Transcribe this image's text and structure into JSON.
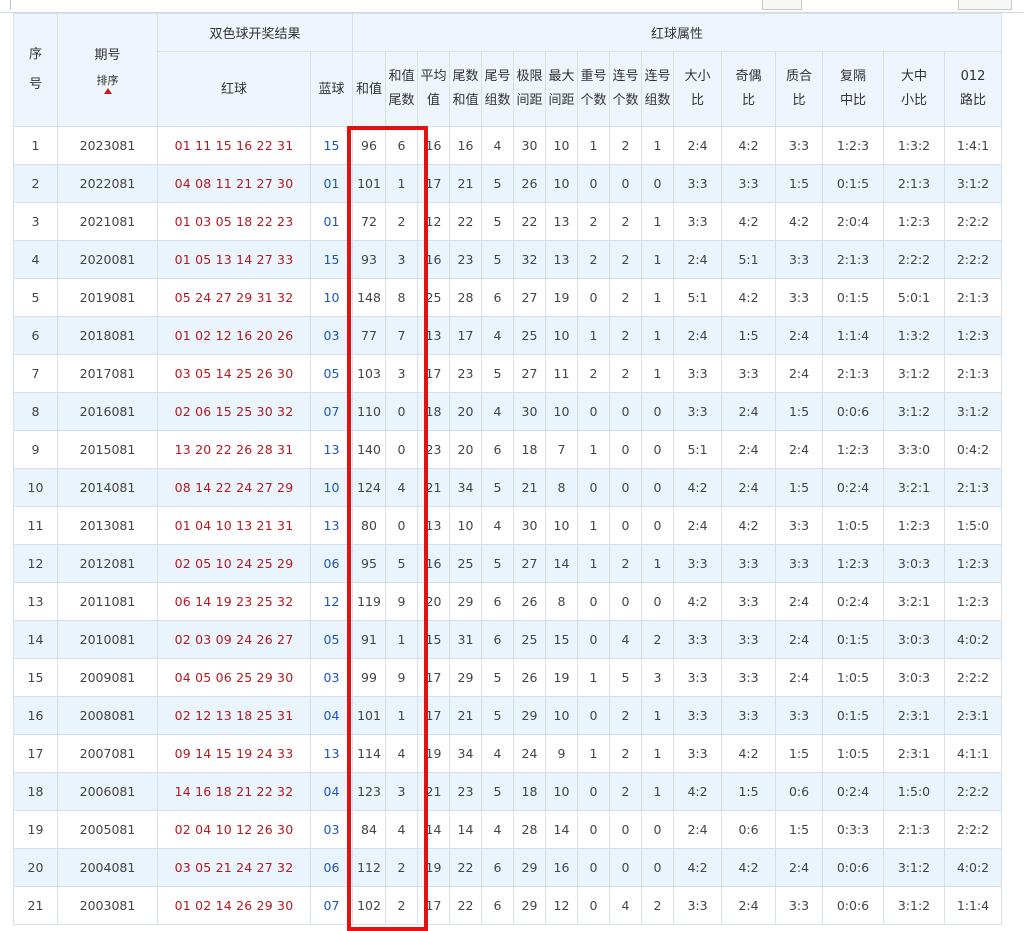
{
  "header": {
    "seq_a": "序",
    "seq_b": "号",
    "period": "期号",
    "sort_label": "排序",
    "result_group": "双色球开奖结果",
    "red_ball": "红球",
    "blue_ball": "蓝球",
    "red_attr_group": "红球属性",
    "cols": {
      "sum": "和值",
      "sum_tail_a": "和值",
      "sum_tail_b": "尾数",
      "avg_a": "平均",
      "avg_b": "值",
      "tail_sum_a": "尾数",
      "tail_sum_b": "和值",
      "tail_groups_a": "尾号",
      "tail_groups_b": "组数",
      "range_a": "极限",
      "range_b": "间距",
      "max_gap_a": "最大",
      "max_gap_b": "间距",
      "repeat_a": "重号",
      "repeat_b": "个数",
      "consec_a": "连号",
      "consec_b": "个数",
      "consec_groups_a": "连号",
      "consec_groups_b": "组数",
      "size_a": "大小",
      "size_b": "比",
      "odd_a": "奇偶",
      "odd_b": "比",
      "prime_a": "质合",
      "prime_b": "比",
      "repeat_ratio_a": "复隔",
      "repeat_ratio_b": "中比",
      "zone_a": "大中",
      "zone_b": "小比",
      "mod_a": "012",
      "mod_b": "路比"
    }
  },
  "rows": [
    [
      "1",
      "2023081",
      "01 11 15 16 22 31",
      "15",
      "96",
      "6",
      "16",
      "16",
      "4",
      "30",
      "10",
      "1",
      "2",
      "1",
      "2:4",
      "4:2",
      "3:3",
      "1:2:3",
      "1:3:2",
      "1:4:1"
    ],
    [
      "2",
      "2022081",
      "04 08 11 21 27 30",
      "01",
      "101",
      "1",
      "17",
      "21",
      "5",
      "26",
      "10",
      "0",
      "0",
      "0",
      "3:3",
      "3:3",
      "1:5",
      "0:1:5",
      "2:1:3",
      "3:1:2"
    ],
    [
      "3",
      "2021081",
      "01 03 05 18 22 23",
      "01",
      "72",
      "2",
      "12",
      "22",
      "5",
      "22",
      "13",
      "2",
      "2",
      "1",
      "3:3",
      "4:2",
      "4:2",
      "2:0:4",
      "1:2:3",
      "2:2:2"
    ],
    [
      "4",
      "2020081",
      "01 05 13 14 27 33",
      "15",
      "93",
      "3",
      "16",
      "23",
      "5",
      "32",
      "13",
      "2",
      "2",
      "1",
      "2:4",
      "5:1",
      "3:3",
      "2:1:3",
      "2:2:2",
      "2:2:2"
    ],
    [
      "5",
      "2019081",
      "05 24 27 29 31 32",
      "10",
      "148",
      "8",
      "25",
      "28",
      "6",
      "27",
      "19",
      "0",
      "2",
      "1",
      "5:1",
      "4:2",
      "3:3",
      "0:1:5",
      "5:0:1",
      "2:1:3"
    ],
    [
      "6",
      "2018081",
      "01 02 12 16 20 26",
      "03",
      "77",
      "7",
      "13",
      "17",
      "4",
      "25",
      "10",
      "1",
      "2",
      "1",
      "2:4",
      "1:5",
      "2:4",
      "1:1:4",
      "1:3:2",
      "1:2:3"
    ],
    [
      "7",
      "2017081",
      "03 05 14 25 26 30",
      "05",
      "103",
      "3",
      "17",
      "23",
      "5",
      "27",
      "11",
      "2",
      "2",
      "1",
      "3:3",
      "3:3",
      "2:4",
      "2:1:3",
      "3:1:2",
      "2:1:3"
    ],
    [
      "8",
      "2016081",
      "02 06 15 25 30 32",
      "07",
      "110",
      "0",
      "18",
      "20",
      "4",
      "30",
      "10",
      "0",
      "0",
      "0",
      "3:3",
      "2:4",
      "1:5",
      "0:0:6",
      "3:1:2",
      "3:1:2"
    ],
    [
      "9",
      "2015081",
      "13 20 22 26 28 31",
      "13",
      "140",
      "0",
      "23",
      "20",
      "6",
      "18",
      "7",
      "1",
      "0",
      "0",
      "5:1",
      "2:4",
      "2:4",
      "1:2:3",
      "3:3:0",
      "0:4:2"
    ],
    [
      "10",
      "2014081",
      "08 14 22 24 27 29",
      "10",
      "124",
      "4",
      "21",
      "34",
      "5",
      "21",
      "8",
      "0",
      "0",
      "0",
      "4:2",
      "2:4",
      "1:5",
      "0:2:4",
      "3:2:1",
      "2:1:3"
    ],
    [
      "11",
      "2013081",
      "01 04 10 13 21 31",
      "13",
      "80",
      "0",
      "13",
      "10",
      "4",
      "30",
      "10",
      "1",
      "0",
      "0",
      "2:4",
      "4:2",
      "3:3",
      "1:0:5",
      "1:2:3",
      "1:5:0"
    ],
    [
      "12",
      "2012081",
      "02 05 10 24 25 29",
      "06",
      "95",
      "5",
      "16",
      "25",
      "5",
      "27",
      "14",
      "1",
      "2",
      "1",
      "3:3",
      "3:3",
      "3:3",
      "1:2:3",
      "3:0:3",
      "1:2:3"
    ],
    [
      "13",
      "2011081",
      "06 14 19 23 25 32",
      "12",
      "119",
      "9",
      "20",
      "29",
      "6",
      "26",
      "8",
      "0",
      "0",
      "0",
      "4:2",
      "3:3",
      "2:4",
      "0:2:4",
      "3:2:1",
      "1:2:3"
    ],
    [
      "14",
      "2010081",
      "02 03 09 24 26 27",
      "05",
      "91",
      "1",
      "15",
      "31",
      "6",
      "25",
      "15",
      "0",
      "4",
      "2",
      "3:3",
      "3:3",
      "2:4",
      "0:1:5",
      "3:0:3",
      "4:0:2"
    ],
    [
      "15",
      "2009081",
      "04 05 06 25 29 30",
      "03",
      "99",
      "9",
      "17",
      "29",
      "5",
      "26",
      "19",
      "1",
      "5",
      "3",
      "3:3",
      "3:3",
      "2:4",
      "1:0:5",
      "3:0:3",
      "2:2:2"
    ],
    [
      "16",
      "2008081",
      "02 12 13 18 25 31",
      "04",
      "101",
      "1",
      "17",
      "21",
      "5",
      "29",
      "10",
      "0",
      "2",
      "1",
      "3:3",
      "3:3",
      "3:3",
      "0:1:5",
      "2:3:1",
      "2:3:1"
    ],
    [
      "17",
      "2007081",
      "09 14 15 19 24 33",
      "13",
      "114",
      "4",
      "19",
      "34",
      "4",
      "24",
      "9",
      "1",
      "2",
      "1",
      "3:3",
      "4:2",
      "1:5",
      "1:0:5",
      "2:3:1",
      "4:1:1"
    ],
    [
      "18",
      "2006081",
      "14 16 18 21 22 32",
      "04",
      "123",
      "3",
      "21",
      "23",
      "5",
      "18",
      "10",
      "0",
      "2",
      "1",
      "4:2",
      "1:5",
      "0:6",
      "0:2:4",
      "1:5:0",
      "2:2:2"
    ],
    [
      "19",
      "2005081",
      "02 04 10 12 26 30",
      "03",
      "84",
      "4",
      "14",
      "14",
      "4",
      "28",
      "14",
      "0",
      "0",
      "0",
      "2:4",
      "0:6",
      "1:5",
      "0:3:3",
      "2:1:3",
      "2:2:2"
    ],
    [
      "20",
      "2004081",
      "03 05 21 24 27 32",
      "06",
      "112",
      "2",
      "19",
      "22",
      "6",
      "29",
      "16",
      "0",
      "0",
      "0",
      "4:2",
      "4:2",
      "2:4",
      "0:0:6",
      "3:1:2",
      "4:0:2"
    ],
    [
      "21",
      "2003081",
      "01 02 14 26 29 30",
      "07",
      "102",
      "2",
      "17",
      "22",
      "6",
      "29",
      "12",
      "0",
      "4",
      "2",
      "3:3",
      "2:4",
      "3:3",
      "0:0:6",
      "3:1:2",
      "1:1:4"
    ]
  ],
  "colors": {
    "red_ball": "#b3191f",
    "blue_ball": "#1a55b8",
    "highlight_box": "#e11212",
    "header_bg": "#eef5fc",
    "row_alt_bg": "#eaf4fc"
  }
}
